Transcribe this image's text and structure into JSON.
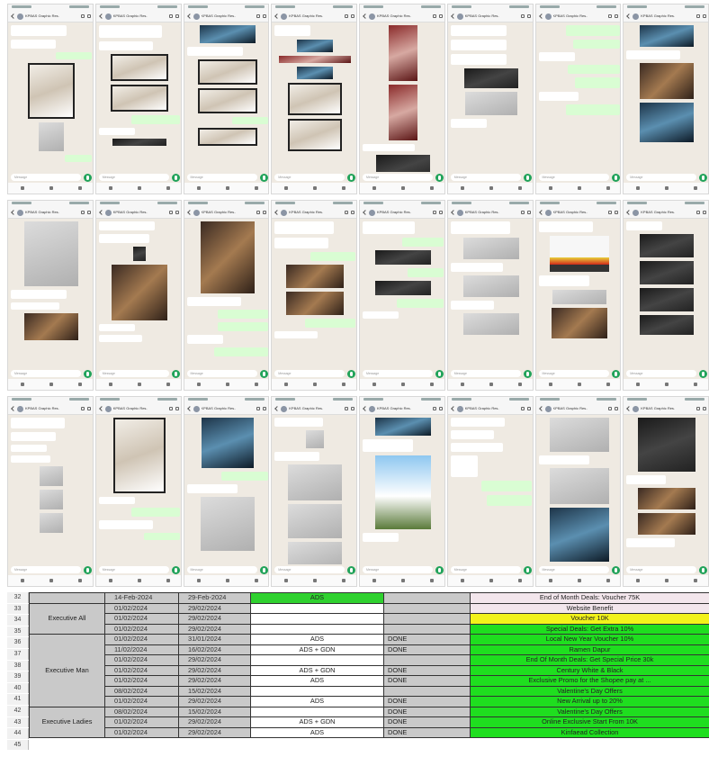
{
  "phones": {
    "chat_title": "KPBAS Graphic Res...",
    "message_placeholder": "Message",
    "rows": [
      {
        "screens": [
          {
            "blocks": [
              [
                "in",
                62,
                12
              ],
              [
                "in",
                50,
                10
              ],
              [
                "out",
                40,
                8
              ],
              [
                "img.l",
                52,
                62
              ],
              [
                "img.g",
                28,
                32
              ],
              [
                "out",
                30,
                8
              ]
            ]
          },
          {
            "blocks": [
              [
                "in",
                70,
                14
              ],
              [
                "in",
                60,
                10
              ],
              [
                "img.l",
                64,
                30
              ],
              [
                "img.l",
                64,
                30
              ],
              [
                "out",
                54,
                10
              ],
              [
                "in",
                40,
                8
              ],
              [
                "img.k",
                60,
                8
              ]
            ]
          },
          {
            "blocks": [
              [
                "img.b",
                62,
                20
              ],
              [
                "in",
                62,
                10
              ],
              [
                "img.l",
                66,
                28
              ],
              [
                "img.l",
                66,
                28
              ],
              [
                "out",
                40,
                8
              ],
              [
                "img.l",
                66,
                20
              ]
            ]
          },
          {
            "blocks": [
              [
                "in",
                40,
                12
              ],
              [
                "img.b",
                40,
                14
              ],
              [
                "img.r",
                80,
                8
              ],
              [
                "img.b",
                40,
                14
              ],
              [
                "img.l",
                60,
                36
              ],
              [
                "img.l",
                60,
                36
              ]
            ]
          },
          {
            "blocks": [
              [
                "img.r",
                32,
                62
              ],
              [
                "img.r",
                32,
                62
              ],
              [
                "in",
                58,
                8
              ],
              [
                "img.k",
                60,
                28
              ],
              [
                "img.k",
                60,
                24
              ]
            ]
          },
          {
            "blocks": [
              [
                "in",
                62,
                12
              ],
              [
                "in",
                62,
                12
              ],
              [
                "in",
                62,
                12
              ],
              [
                "img.k",
                60,
                22
              ],
              [
                "img.g",
                58,
                26
              ],
              [
                "in",
                40,
                10
              ]
            ]
          },
          {
            "blocks": [
              [
                "out",
                60,
                12
              ],
              [
                "out",
                52,
                10
              ],
              [
                "in",
                40,
                10
              ],
              [
                "out",
                58,
                10
              ],
              [
                "out",
                50,
                12
              ],
              [
                "in",
                44,
                10
              ],
              [
                "out",
                60,
                12
              ]
            ]
          },
          {
            "blocks": [
              [
                "img.b",
                60,
                24
              ],
              [
                "in",
                60,
                10
              ],
              [
                "img.d",
                60,
                40
              ],
              [
                "img.b",
                60,
                44
              ]
            ]
          }
        ]
      },
      {
        "screens": [
          {
            "blocks": [
              [
                "img.g",
                60,
                72
              ],
              [
                "in",
                62,
                10
              ],
              [
                "in",
                54,
                8
              ],
              [
                "img.d",
                60,
                30
              ]
            ]
          },
          {
            "blocks": [
              [
                "in",
                62,
                10
              ],
              [
                "in",
                56,
                10
              ],
              [
                "img.k",
                14,
                16
              ],
              [
                "img.d",
                62,
                62
              ],
              [
                "in",
                40,
                8
              ],
              [
                "in",
                48,
                8
              ]
            ]
          },
          {
            "blocks": [
              [
                "img.d",
                60,
                80
              ],
              [
                "in",
                60,
                10
              ],
              [
                "out",
                56,
                10
              ],
              [
                "out",
                56,
                10
              ],
              [
                "in",
                40,
                10
              ],
              [
                "out",
                60,
                10
              ]
            ]
          },
          {
            "blocks": [
              [
                "in",
                66,
                14
              ],
              [
                "in",
                60,
                12
              ],
              [
                "out",
                50,
                10
              ],
              [
                "img.d",
                64,
                26
              ],
              [
                "img.d",
                64,
                26
              ],
              [
                "out",
                56,
                10
              ],
              [
                "in",
                48,
                8
              ]
            ]
          },
          {
            "blocks": [
              [
                "in",
                58,
                14
              ],
              [
                "out",
                46,
                10
              ],
              [
                "img.k",
                62,
                16
              ],
              [
                "out",
                40,
                10
              ],
              [
                "img.k",
                62,
                16
              ],
              [
                "out",
                52,
                10
              ],
              [
                "in",
                40,
                8
              ]
            ]
          },
          {
            "blocks": [
              [
                "in",
                66,
                14
              ],
              [
                "img.g",
                62,
                24
              ],
              [
                "in",
                58,
                10
              ],
              [
                "img.g",
                62,
                24
              ],
              [
                "in",
                48,
                10
              ],
              [
                "img.g",
                62,
                24
              ]
            ]
          },
          {
            "blocks": [
              [
                "in",
                60,
                12
              ],
              [
                "img.y",
                66,
                40
              ],
              [
                "in",
                56,
                12
              ],
              [
                "img.g",
                60,
                16
              ],
              [
                "img.d",
                62,
                34
              ]
            ]
          },
          {
            "blocks": [
              [
                "in",
                40,
                10
              ],
              [
                "img.k",
                60,
                26
              ],
              [
                "img.k",
                60,
                26
              ],
              [
                "img.k",
                60,
                26
              ],
              [
                "img.k",
                60,
                22
              ]
            ]
          }
        ]
      },
      {
        "screens": [
          {
            "blocks": [
              [
                "in",
                60,
                12
              ],
              [
                "in",
                50,
                10
              ],
              [
                "in",
                40,
                8
              ],
              [
                "in",
                44,
                8
              ],
              [
                "img.g",
                26,
                22
              ],
              [
                "img.g",
                26,
                22
              ],
              [
                "img.g",
                26,
                22
              ]
            ]
          },
          {
            "blocks": [
              [
                "img.l",
                58,
                84
              ],
              [
                "in",
                40,
                8
              ],
              [
                "out",
                54,
                10
              ],
              [
                "in",
                60,
                10
              ],
              [
                "out",
                40,
                8
              ]
            ]
          },
          {
            "blocks": [
              [
                "img.b",
                58,
                56
              ],
              [
                "out",
                52,
                10
              ],
              [
                "in",
                56,
                10
              ],
              [
                "img.g",
                60,
                60
              ]
            ]
          },
          {
            "blocks": [
              [
                "in",
                54,
                10
              ],
              [
                "img.g",
                20,
                20
              ],
              [
                "in",
                50,
                10
              ],
              [
                "img.g",
                60,
                40
              ],
              [
                "img.g",
                60,
                38
              ],
              [
                "img.g",
                60,
                30
              ]
            ]
          },
          {
            "blocks": [
              [
                "img.b",
                62,
                20
              ],
              [
                "in",
                56,
                14
              ],
              [
                "img.s",
                62,
                82
              ],
              [
                "in",
                40,
                10
              ]
            ]
          },
          {
            "blocks": [
              [
                "in",
                60,
                10
              ],
              [
                "in",
                48,
                10
              ],
              [
                "in",
                58,
                10
              ],
              [
                "in",
                30,
                24
              ],
              [
                "out",
                56,
                12
              ],
              [
                "out",
                50,
                12
              ]
            ]
          },
          {
            "blocks": [
              [
                "img.g",
                66,
                38
              ],
              [
                "in",
                56,
                10
              ],
              [
                "img.g",
                66,
                40
              ],
              [
                "img.b",
                66,
                60
              ]
            ]
          },
          {
            "blocks": [
              [
                "img.k",
                64,
                60
              ],
              [
                "in",
                44,
                10
              ],
              [
                "img.d",
                64,
                24
              ],
              [
                "img.d",
                64,
                24
              ],
              [
                "in",
                54,
                10
              ]
            ]
          }
        ]
      }
    ]
  },
  "sheet": {
    "rows": [
      {
        "n": "32",
        "cat": "",
        "start": "14-Feb-2024",
        "end": "29-Feb-2024",
        "channel": "ADS",
        "status": "",
        "promo": "End of Month Deals: Voucher 75K",
        "promo_color": "#f3e6ec",
        "channel_color": "#2fd12f"
      },
      {
        "n": "33",
        "cat": "Executive All",
        "start": "01/02/2024",
        "end": "29/02/2024",
        "channel": "",
        "status": "",
        "promo": "Website Benefit",
        "promo_color": "#f3e6ec",
        "channel_color": ""
      },
      {
        "n": "34",
        "cat": "",
        "start": "01/02/2024",
        "end": "29/02/2024",
        "channel": "",
        "status": "",
        "promo": "Voucher 10K",
        "promo_color": "#f2f21a",
        "channel_color": ""
      },
      {
        "n": "35",
        "cat": "",
        "start": "01/02/2024",
        "end": "29/02/2024",
        "channel": "",
        "status": "",
        "promo": "Special Deals: Get Extra 10%",
        "promo_color": "#1fde1f",
        "channel_color": ""
      },
      {
        "n": "36",
        "cat": "",
        "start": "01/02/2024",
        "end": "31/01/2024",
        "channel": "ADS",
        "status": "DONE",
        "promo": "Local New Year Voucher 10%",
        "promo_color": "#1fde1f",
        "channel_color": ""
      },
      {
        "n": "37",
        "cat": "",
        "start": "11/02/2024",
        "end": "16/02/2024",
        "channel": "ADS + GDN",
        "status": "DONE",
        "promo": "Ramen Dapur",
        "promo_color": "#1fde1f",
        "channel_color": ""
      },
      {
        "n": "38",
        "cat": "Executive Man",
        "start": "01/02/2024",
        "end": "29/02/2024",
        "channel": "",
        "status": "",
        "promo": "End Of Month Deals: Get Special Price 30k",
        "promo_color": "#1fde1f",
        "channel_color": ""
      },
      {
        "n": "39",
        "cat": "",
        "start": "01/02/2024",
        "end": "29/02/2024",
        "channel": "ADS + GDN",
        "status": "DONE",
        "promo": "Century White & Black",
        "promo_color": "#1fde1f",
        "channel_color": ""
      },
      {
        "n": "40",
        "cat": "",
        "start": "01/02/2024",
        "end": "29/02/2024",
        "channel": "ADS",
        "status": "DONE",
        "promo": "Exclusive Promo for the Shopee pay at ...",
        "promo_color": "#1fde1f",
        "channel_color": ""
      },
      {
        "n": "41",
        "cat": "",
        "start": "08/02/2024",
        "end": "15/02/2024",
        "channel": "",
        "status": "",
        "promo": "Valentine's Day Offers",
        "promo_color": "#1fde1f",
        "channel_color": ""
      },
      {
        "n": "42",
        "cat": "",
        "start": "01/02/2024",
        "end": "29/02/2024",
        "channel": "ADS",
        "status": "DONE",
        "promo": "New Arrival up to 20%",
        "promo_color": "#1fde1f",
        "channel_color": ""
      },
      {
        "n": "43",
        "cat": "Executive Ladies",
        "start": "08/02/2024",
        "end": "15/02/2024",
        "channel": "",
        "status": "DONE",
        "promo": "Valentine's Day Offers",
        "promo_color": "#1fde1f",
        "channel_color": ""
      },
      {
        "n": "44",
        "cat": "",
        "start": "01/02/2024",
        "end": "29/02/2024",
        "channel": "ADS + GDN",
        "status": "DONE",
        "promo": "Online Exclusive Start From 10K",
        "promo_color": "#1fde1f",
        "channel_color": ""
      },
      {
        "n": "45",
        "cat": "",
        "start": "01/02/2024",
        "end": "29/02/2024",
        "channel": "ADS",
        "status": "DONE",
        "promo": "Kinfaead Collection",
        "promo_color": "#1fde1f",
        "channel_color": ""
      }
    ]
  }
}
